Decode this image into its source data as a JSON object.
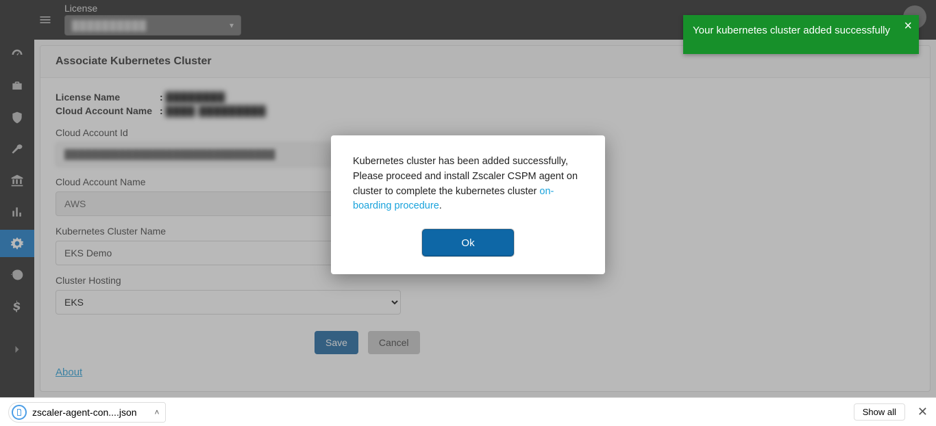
{
  "header": {
    "license_label": "License",
    "license_selected": "██████████"
  },
  "sidebar": {
    "items": [
      {
        "name": "dashboard",
        "icon": "gauge"
      },
      {
        "name": "inventory",
        "icon": "briefcase"
      },
      {
        "name": "compliance",
        "icon": "shield"
      },
      {
        "name": "tools",
        "icon": "wrench"
      },
      {
        "name": "governance",
        "icon": "bank"
      },
      {
        "name": "reports",
        "icon": "chart"
      },
      {
        "name": "settings",
        "icon": "gears",
        "active": true
      },
      {
        "name": "history",
        "icon": "history"
      },
      {
        "name": "billing",
        "icon": "dollar"
      }
    ]
  },
  "panel": {
    "title": "Associate Kubernetes Cluster",
    "meta": {
      "license_name_label": "License Name",
      "license_name_value": "████████",
      "cloud_account_name_label": "Cloud Account Name",
      "cloud_account_name_value": "████ █████████"
    },
    "fields": {
      "cloud_account_id": {
        "label": "Cloud Account Id",
        "value": "███████████████████████████████"
      },
      "cloud_account_name": {
        "label": "Cloud Account Name",
        "value": "AWS"
      },
      "k8s_cluster_name": {
        "label": "Kubernetes Cluster Name",
        "value": "EKS Demo"
      },
      "cluster_hosting": {
        "label": "Cluster Hosting",
        "value": "EKS"
      }
    },
    "buttons": {
      "save": "Save",
      "cancel": "Cancel"
    },
    "about": "About"
  },
  "modal": {
    "text_before_link": "Kubernetes cluster has been added successfully, Please proceed and install Zscaler CSPM agent on cluster to complete the kubernetes cluster ",
    "link_text": "on-boarding procedure",
    "text_after_link": ".",
    "ok": "Ok"
  },
  "toast": {
    "message": "Your kubernetes cluster added successfully"
  },
  "download_bar": {
    "filename": "zscaler-agent-con....json",
    "show_all": "Show all"
  }
}
